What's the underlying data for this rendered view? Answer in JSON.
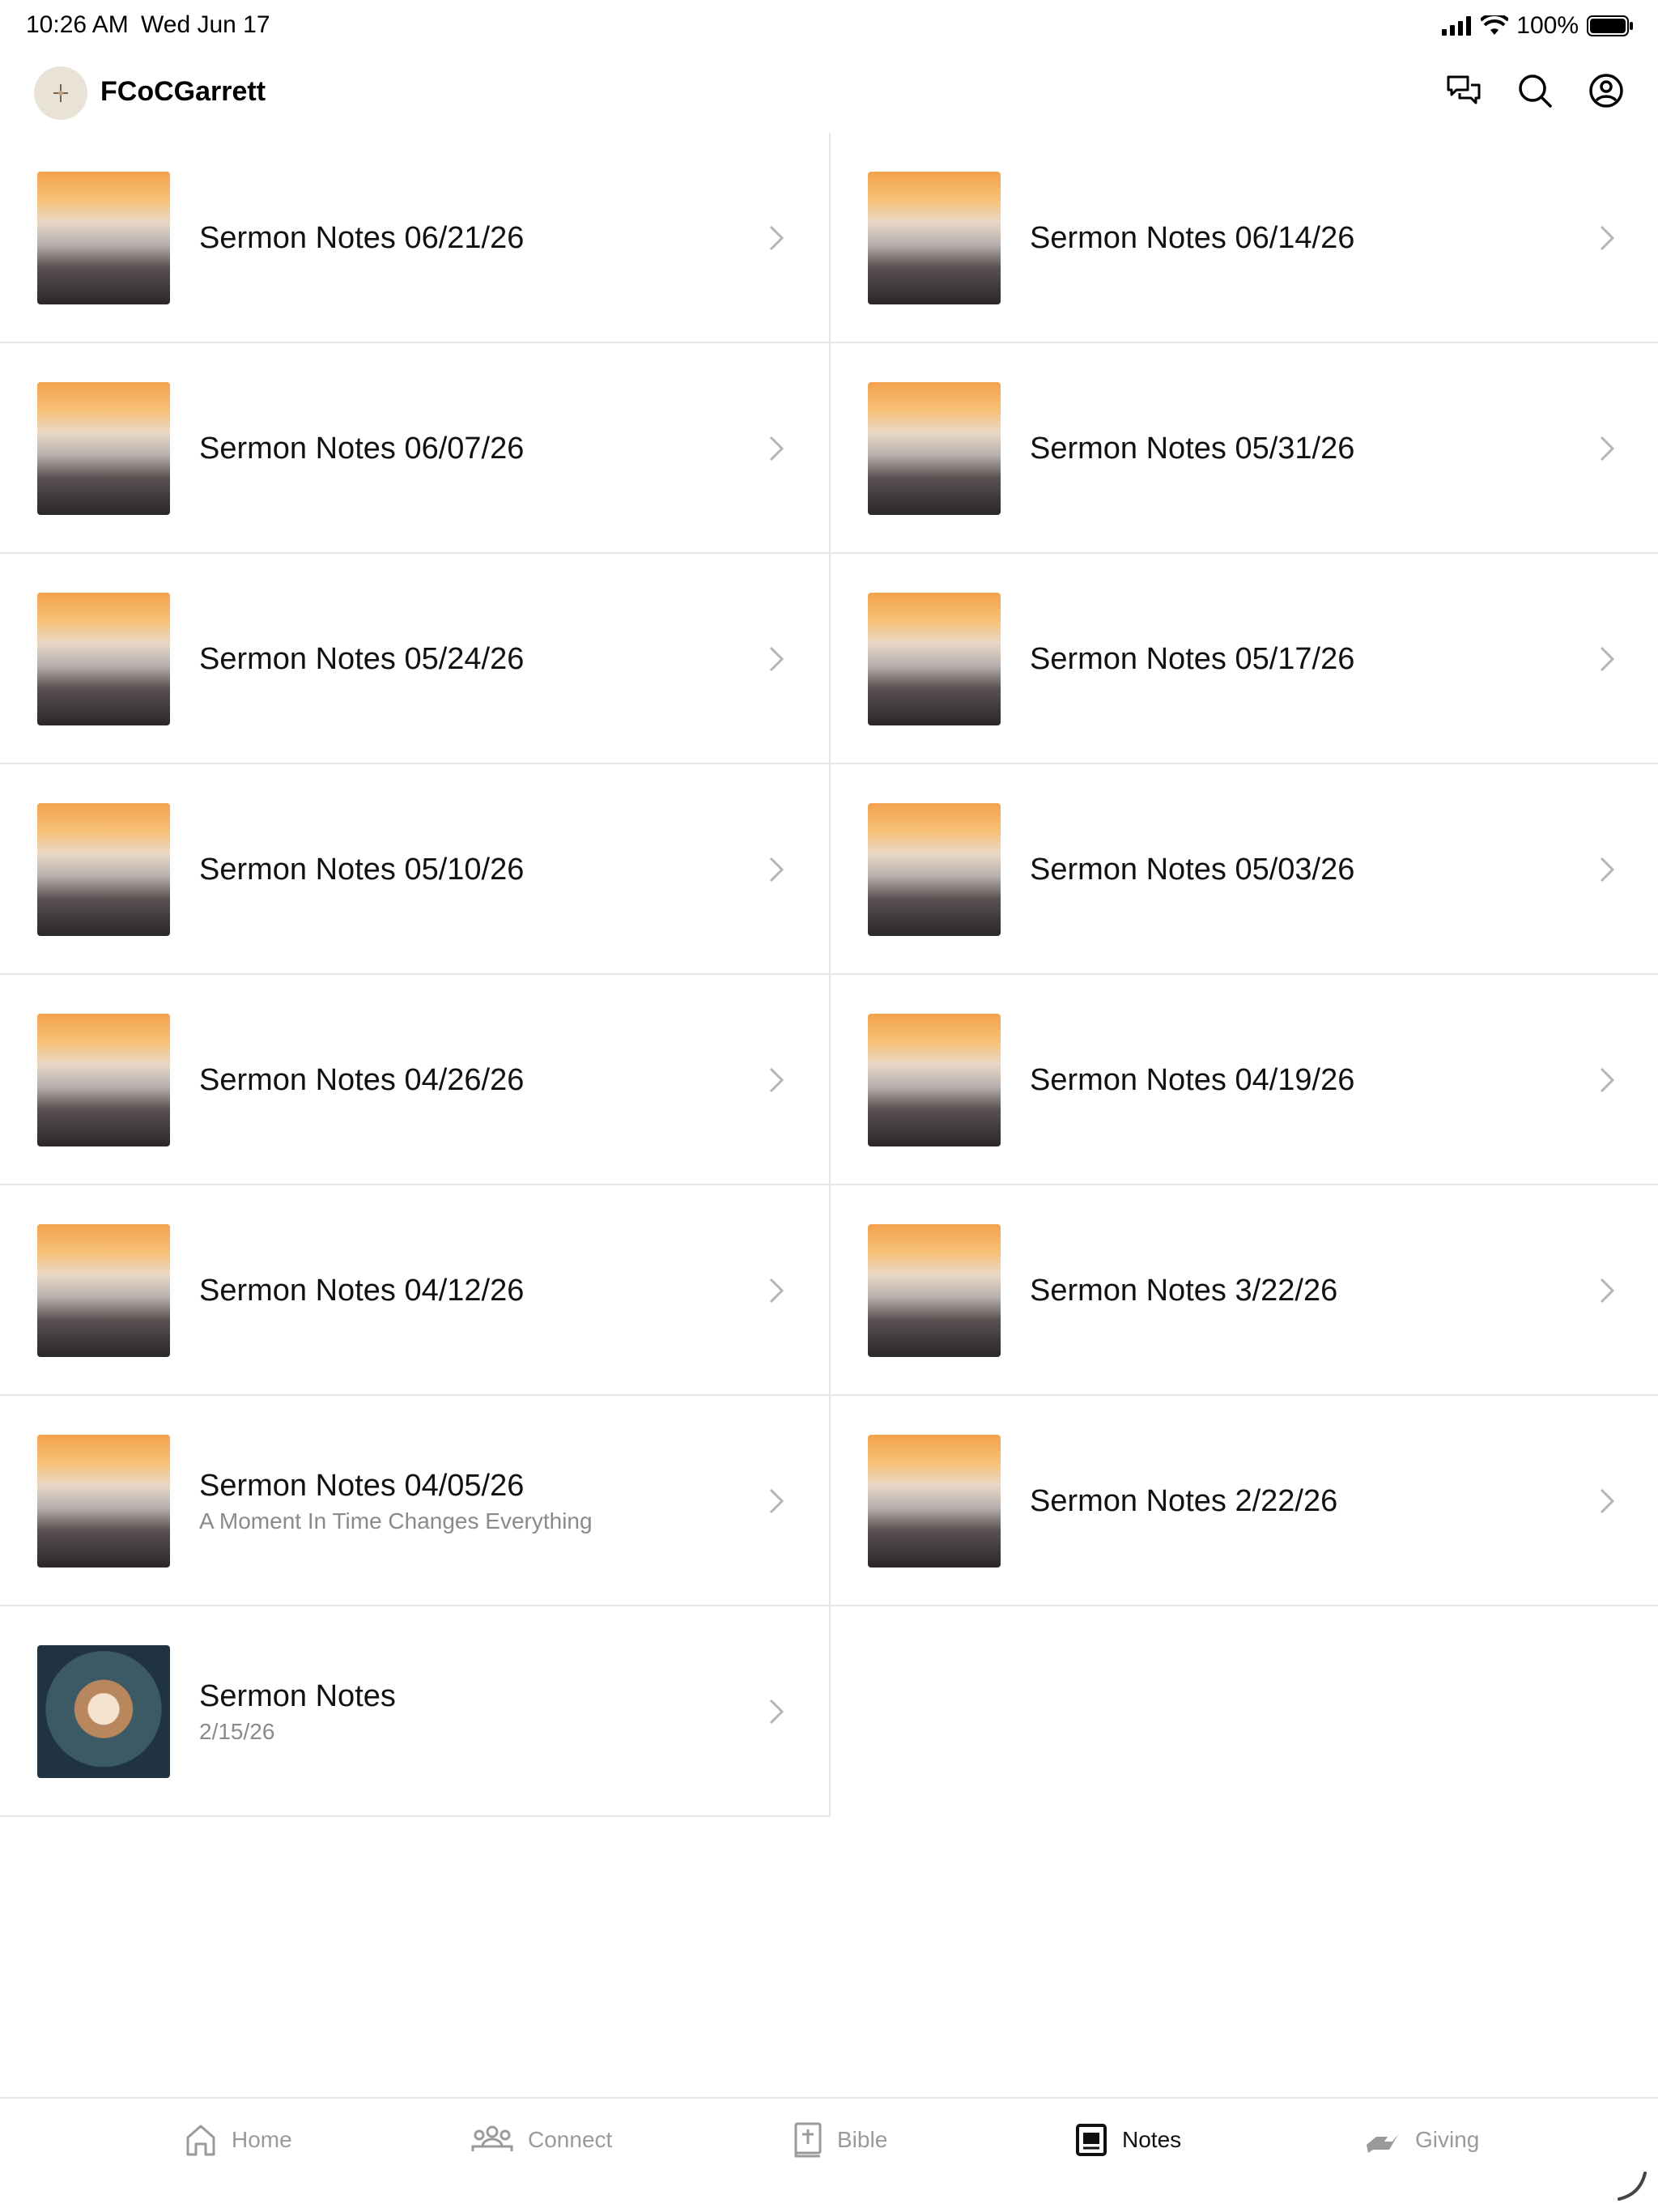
{
  "status": {
    "time": "10:26 AM",
    "date": "Wed Jun 17",
    "battery": "100%"
  },
  "header": {
    "title": "FCoCGarrett",
    "icons": [
      "chat-icon",
      "search-icon",
      "profile-icon"
    ]
  },
  "notes": [
    {
      "title": "Sermon Notes 06/21/26",
      "subtitle": "",
      "image": "sunset"
    },
    {
      "title": "Sermon Notes 06/14/26",
      "subtitle": "",
      "image": "sunset"
    },
    {
      "title": "Sermon Notes 06/07/26",
      "subtitle": "",
      "image": "sunset"
    },
    {
      "title": "Sermon Notes 05/31/26",
      "subtitle": "",
      "image": "sunset"
    },
    {
      "title": "Sermon Notes 05/24/26",
      "subtitle": "",
      "image": "sunset"
    },
    {
      "title": "Sermon Notes 05/17/26",
      "subtitle": "",
      "image": "sunset"
    },
    {
      "title": "Sermon Notes 05/10/26",
      "subtitle": "",
      "image": "sunset"
    },
    {
      "title": "Sermon Notes 05/03/26",
      "subtitle": "",
      "image": "sunset"
    },
    {
      "title": "Sermon Notes 04/26/26",
      "subtitle": "",
      "image": "sunset"
    },
    {
      "title": "Sermon Notes 04/19/26",
      "subtitle": "",
      "image": "sunset"
    },
    {
      "title": "Sermon Notes 04/12/26",
      "subtitle": "",
      "image": "sunset"
    },
    {
      "title": "Sermon Notes 3/22/26",
      "subtitle": "",
      "image": "sunset"
    },
    {
      "title": "Sermon Notes 04/05/26",
      "subtitle": "A Moment In Time Changes Everything",
      "image": "sunset"
    },
    {
      "title": "Sermon Notes 2/22/26",
      "subtitle": "",
      "image": "sunset"
    },
    {
      "title": "Sermon Notes",
      "subtitle": "2/15/26",
      "image": "coffee"
    }
  ],
  "tabs": [
    {
      "label": "Home",
      "icon": "home-icon",
      "active": false
    },
    {
      "label": "Connect",
      "icon": "people-icon",
      "active": false
    },
    {
      "label": "Bible",
      "icon": "bible-icon",
      "active": false
    },
    {
      "label": "Notes",
      "icon": "notes-icon",
      "active": true
    },
    {
      "label": "Giving",
      "icon": "giving-icon",
      "active": false
    }
  ],
  "colors": {
    "divider": "#e6e6e6",
    "inactive_tab": "#9a9a9a",
    "active_tab": "#111111"
  }
}
